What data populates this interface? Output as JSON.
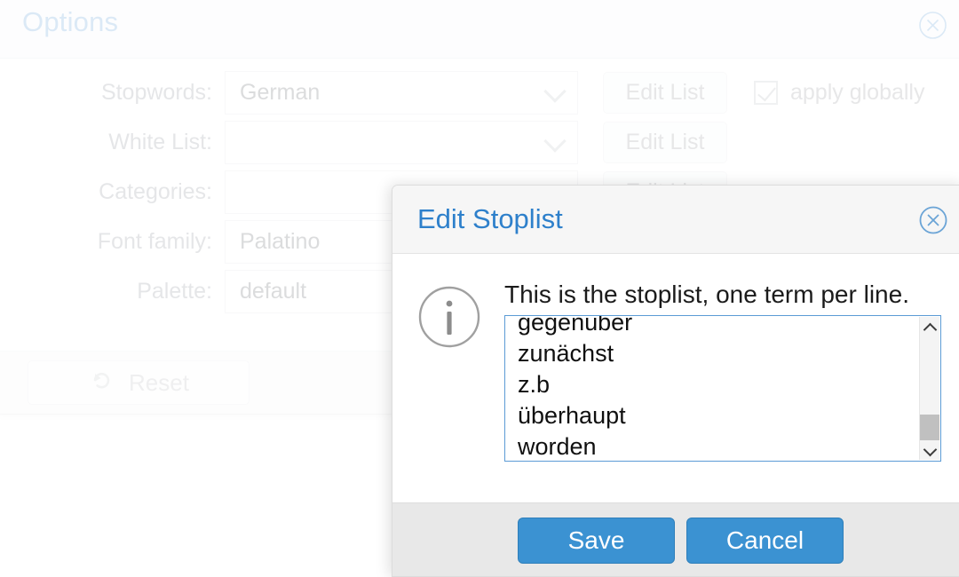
{
  "options_dialog": {
    "title": "Options",
    "close_icon": "close-circle-icon",
    "rows": [
      {
        "label": "Stopwords:",
        "value": "German",
        "edit_label": "Edit List"
      },
      {
        "label": "White List:",
        "value": "",
        "edit_label": "Edit List"
      },
      {
        "label": "Categories:",
        "value": "",
        "edit_label": "Edit List"
      },
      {
        "label": "Font family:",
        "value": "Palatino"
      },
      {
        "label": "Palette:",
        "value": "default"
      }
    ],
    "apply_globally": {
      "label": "apply globally",
      "checked": true
    },
    "reset_label": "Reset",
    "reset_icon": "undo-arrow-icon"
  },
  "stoplist_modal": {
    "title": "Edit Stoplist",
    "close_icon": "close-circle-icon",
    "info_icon": "info-circle-icon",
    "message": "This is the stoplist, one term per line.",
    "textarea_value": "gegenüber\nzunächst\nz.b\nüberhaupt\nworden",
    "scrollbar": {
      "up_icon": "chevron-up-icon",
      "down_icon": "chevron-down-icon"
    },
    "save_label": "Save",
    "cancel_label": "Cancel"
  },
  "colors": {
    "accent_blue": "#3b92d2",
    "title_blue": "#2e80cb",
    "options_title_blue": "#9ec5e8",
    "footer_gray": "#e8e8e8",
    "textarea_border": "#5b9bd5"
  }
}
